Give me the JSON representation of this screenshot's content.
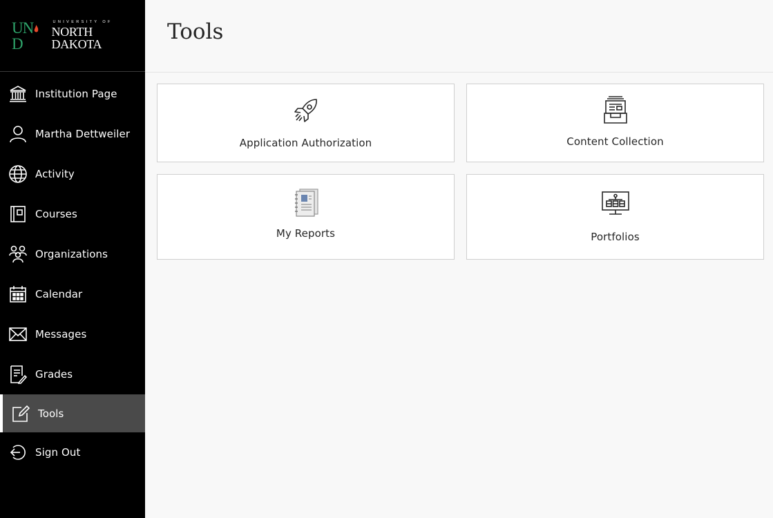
{
  "brand": {
    "logo_prefix": "UND",
    "logo_small": "UNIVERSITY OF",
    "logo_big": "NORTH DAKOTA"
  },
  "nav": {
    "items": [
      {
        "label": "Institution Page",
        "icon": "institution-icon"
      },
      {
        "label": "Martha Dettweiler",
        "icon": "user-icon"
      },
      {
        "label": "Activity",
        "icon": "globe-icon"
      },
      {
        "label": "Courses",
        "icon": "courses-icon"
      },
      {
        "label": "Organizations",
        "icon": "organizations-icon"
      },
      {
        "label": "Calendar",
        "icon": "calendar-icon"
      },
      {
        "label": "Messages",
        "icon": "envelope-icon"
      },
      {
        "label": "Grades",
        "icon": "grades-icon"
      },
      {
        "label": "Tools",
        "icon": "tools-icon",
        "active": true
      },
      {
        "label": "Sign Out",
        "icon": "sign-out-icon"
      }
    ]
  },
  "page": {
    "title": "Tools"
  },
  "tools": [
    {
      "label": "Application Authorization",
      "icon": "rocket-icon"
    },
    {
      "label": "Content Collection",
      "icon": "content-collection-icon"
    },
    {
      "label": "My Reports",
      "icon": "reports-icon"
    },
    {
      "label": "Portfolios",
      "icon": "portfolio-icon"
    }
  ],
  "colors": {
    "sidebar_bg": "#000000",
    "active_bg": "#4a4a4a",
    "brand_green": "#2ea36a",
    "page_bg": "#f8f8f8"
  }
}
